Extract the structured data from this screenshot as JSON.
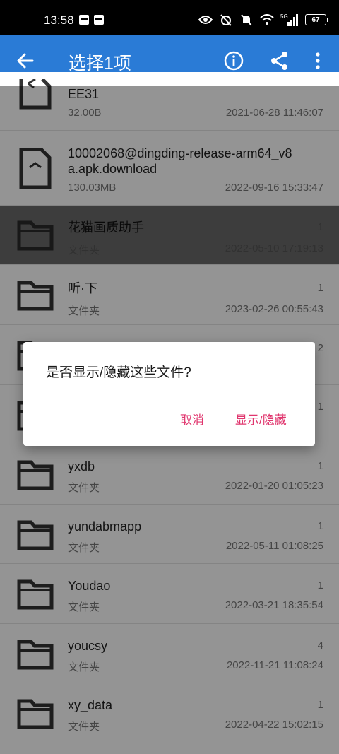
{
  "status_bar": {
    "time": "13:58",
    "battery": "67",
    "network": "5G"
  },
  "app_bar": {
    "title": "选择1项",
    "icons": [
      "back-arrow-icon",
      "info-icon",
      "share-icon",
      "more-vert-icon"
    ]
  },
  "files": [
    {
      "name": "EE31",
      "sub": "32.00B",
      "count": "",
      "date": "2021-06-28 11:46:07",
      "type": "file"
    },
    {
      "name": "10002068@dingding-release-arm64_v8a.apk.download",
      "sub": "130.03MB",
      "count": "",
      "date": "2022-09-16 15:33:47",
      "type": "file"
    },
    {
      "name": "花猫画质助手",
      "sub": "文件夹",
      "count": "1",
      "date": "2022-05-10 17:19:13",
      "type": "folder",
      "selected": true
    },
    {
      "name": "听·下",
      "sub": "文件夹",
      "count": "1",
      "date": "2023-02-26 00:55:43",
      "type": "folder"
    },
    {
      "name": "",
      "sub": "",
      "count": "2",
      "date": "",
      "type": "folder"
    },
    {
      "name": "",
      "sub": "",
      "count": "1",
      "date": "",
      "type": "folder"
    },
    {
      "name": "yxdb",
      "sub": "文件夹",
      "count": "1",
      "date": "2022-01-20 01:05:23",
      "type": "folder"
    },
    {
      "name": "yundabmapp",
      "sub": "文件夹",
      "count": "1",
      "date": "2022-05-11 01:08:25",
      "type": "folder"
    },
    {
      "name": "Youdao",
      "sub": "文件夹",
      "count": "1",
      "date": "2022-03-21 18:35:54",
      "type": "folder"
    },
    {
      "name": "youcsy",
      "sub": "文件夹",
      "count": "4",
      "date": "2022-11-21 11:08:24",
      "type": "folder"
    },
    {
      "name": "xy_data",
      "sub": "文件夹",
      "count": "1",
      "date": "2022-04-22 15:02:15",
      "type": "folder"
    }
  ],
  "dialog": {
    "message": "是否显示/隐藏这些文件?",
    "cancel_label": "取消",
    "confirm_label": "显示/隐藏"
  },
  "colors": {
    "app_bar": "#2a7bd6",
    "accent": "#e0366e",
    "selected_row": "#6a6a6a"
  }
}
